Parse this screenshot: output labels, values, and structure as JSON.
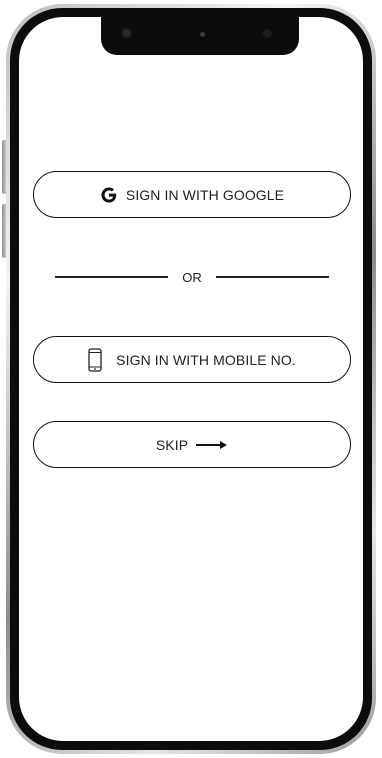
{
  "signin": {
    "google_label": "SIGN IN WITH GOOGLE",
    "or_label": "OR",
    "mobile_label": "SIGN IN WITH MOBILE NO.",
    "skip_label": "SKIP"
  },
  "icons": {
    "google": "google-g-icon",
    "mobile": "mobile-phone-icon",
    "skip": "arrow-right-icon"
  },
  "colors": {
    "outline": "#111111",
    "text": "#222222",
    "background": "#ffffff"
  }
}
